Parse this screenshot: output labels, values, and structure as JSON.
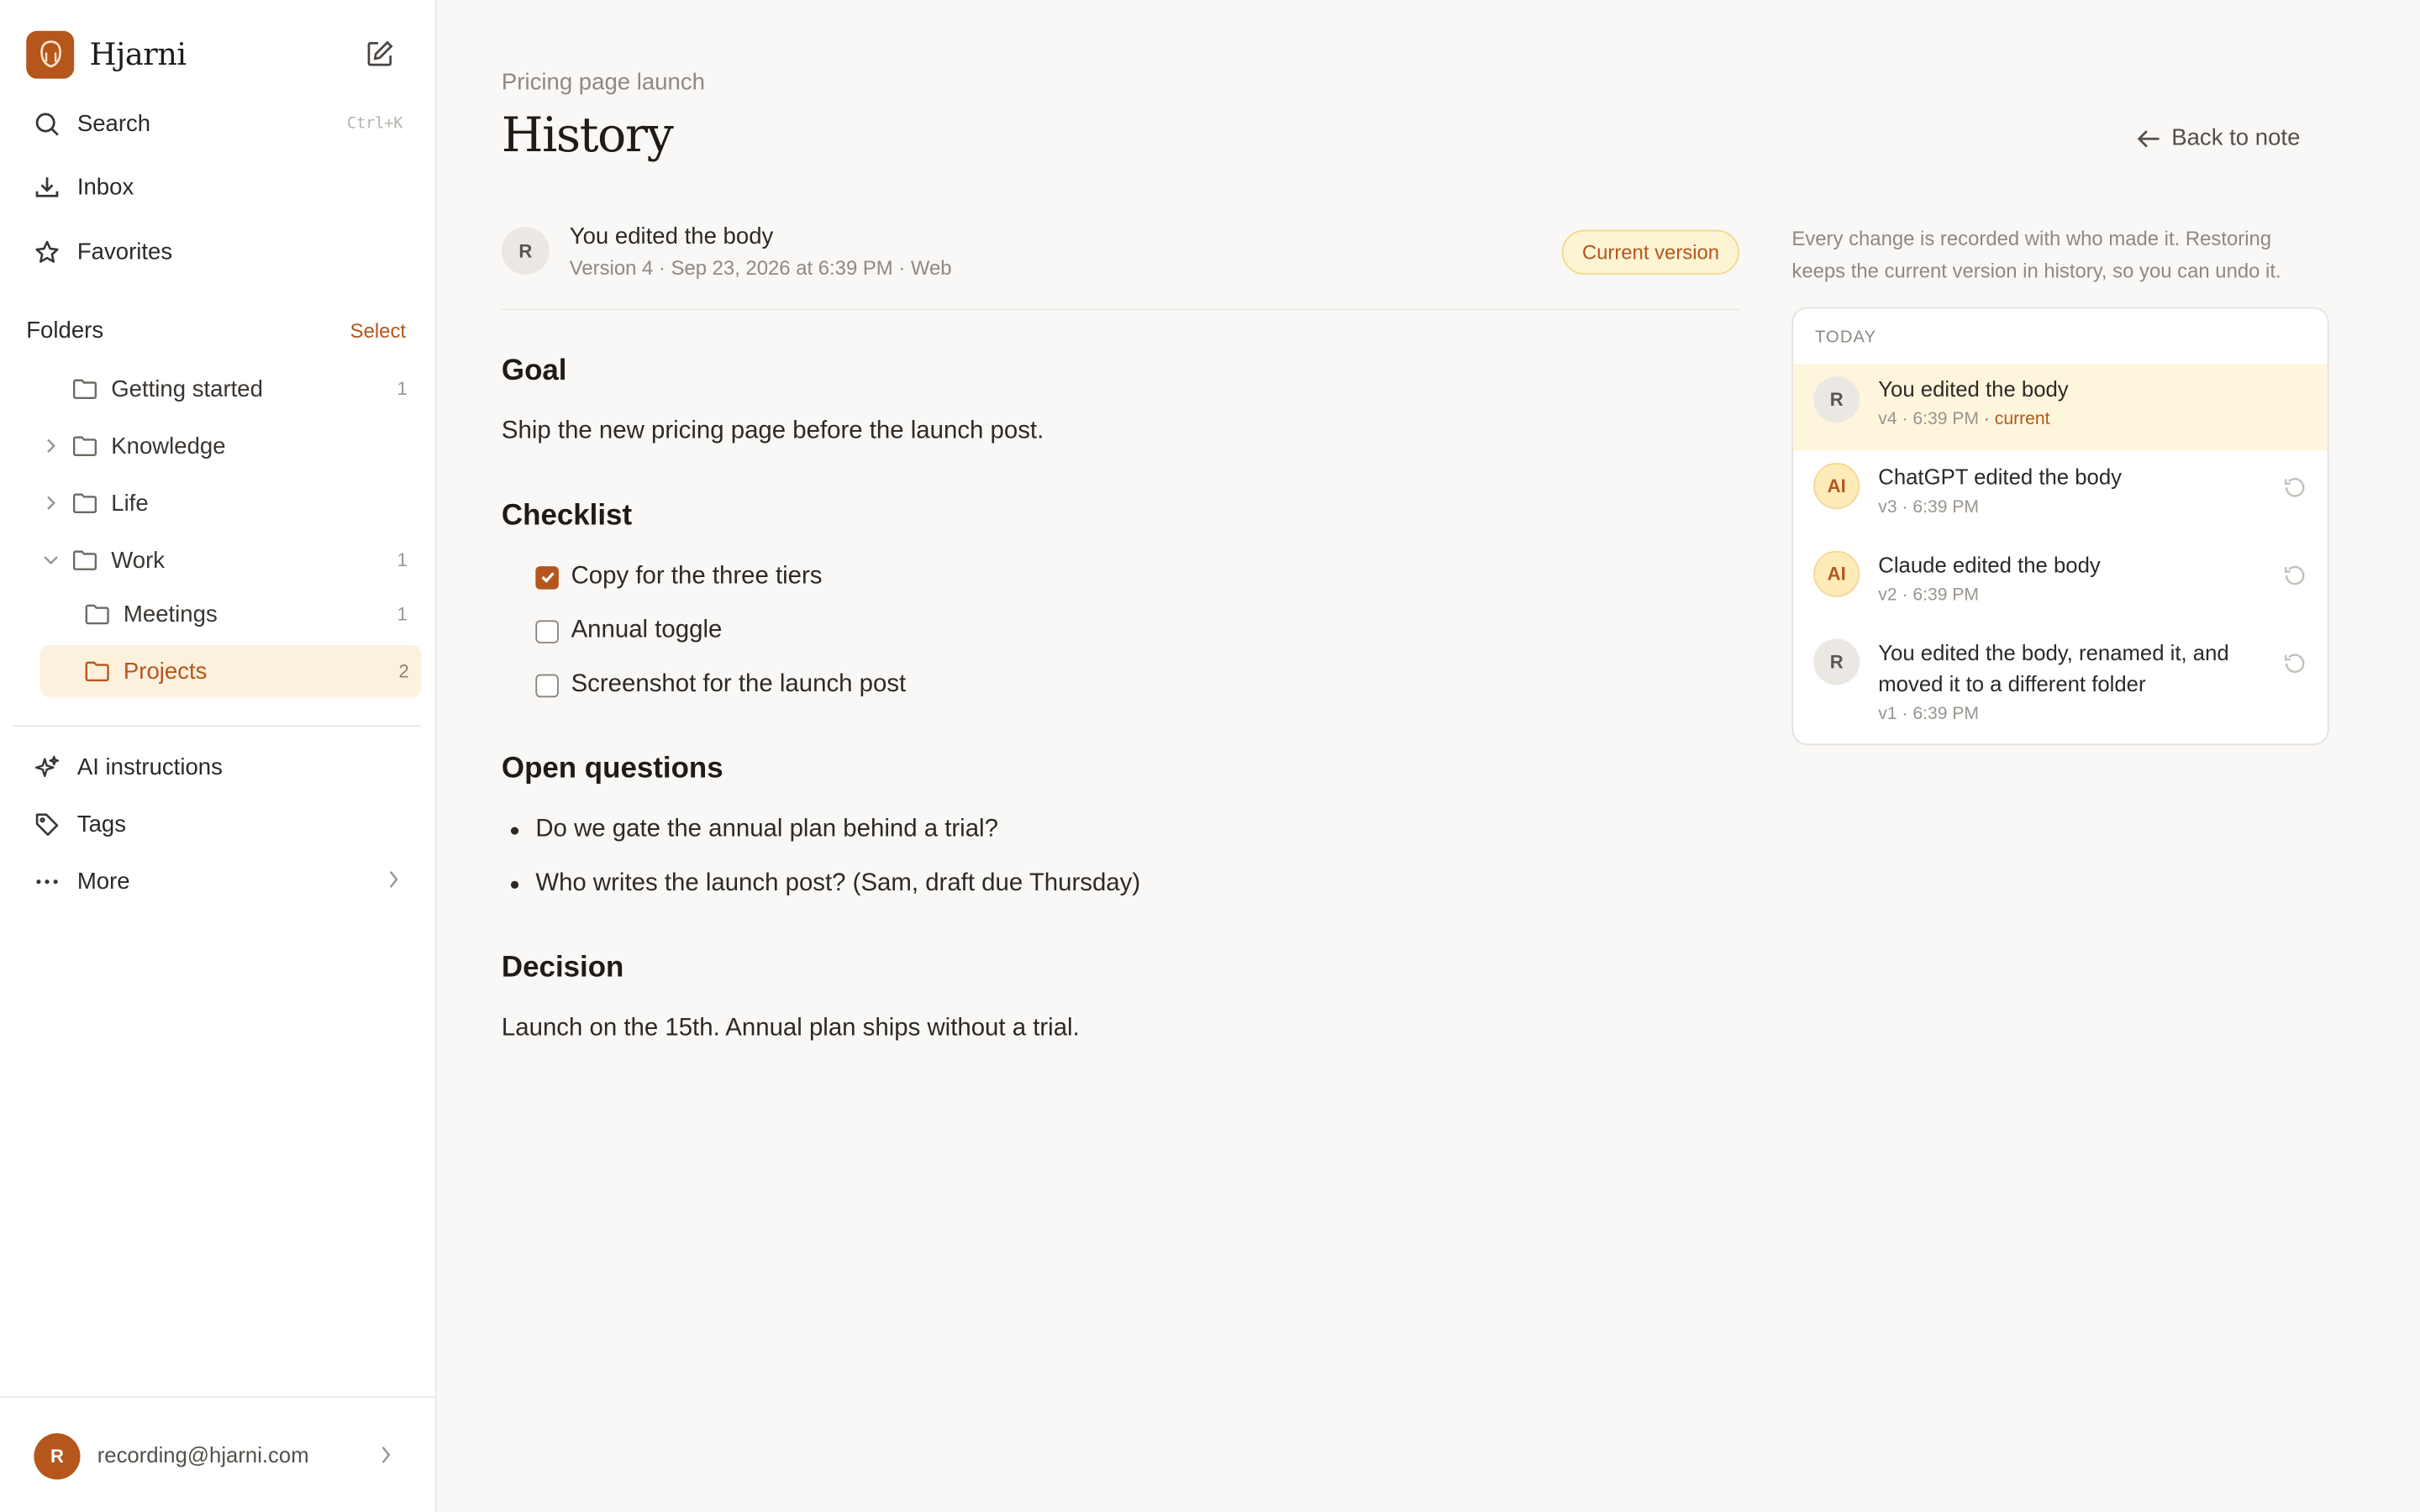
{
  "app": {
    "name": "Hjarni"
  },
  "sidebar": {
    "nav": [
      {
        "label": "Search",
        "shortcut": "Ctrl+K"
      },
      {
        "label": "Inbox"
      },
      {
        "label": "Favorites"
      }
    ],
    "folders_title": "Folders",
    "select_label": "Select",
    "folders": [
      {
        "label": "Getting started",
        "count": "1"
      },
      {
        "label": "Knowledge",
        "count": ""
      },
      {
        "label": "Life",
        "count": ""
      },
      {
        "label": "Work",
        "count": "1"
      },
      {
        "label": "Meetings",
        "count": "1"
      },
      {
        "label": "Projects",
        "count": "2"
      }
    ],
    "bottom": [
      {
        "label": "AI instructions"
      },
      {
        "label": "Tags"
      },
      {
        "label": "More"
      }
    ],
    "user": {
      "initial": "R",
      "email": "recording@hjarni.com"
    }
  },
  "main": {
    "breadcrumb": "Pricing page launch",
    "title": "History",
    "back_label": "Back to note",
    "version": {
      "initial": "R",
      "title": "You edited the body",
      "meta": "Version 4 · Sep 23, 2026 at 6:39 PM · Web",
      "badge": "Current version"
    },
    "content": {
      "goal_heading": "Goal",
      "goal_text": "Ship the new pricing page before the launch post.",
      "checklist_heading": "Checklist",
      "checklist": [
        {
          "label": "Copy for the three tiers",
          "checked": true
        },
        {
          "label": "Annual toggle",
          "checked": false
        },
        {
          "label": "Screenshot for the launch post",
          "checked": false
        }
      ],
      "questions_heading": "Open questions",
      "questions": [
        "Do we gate the annual plan behind a trial?",
        "Who writes the launch post? (Sam, draft due Thursday)"
      ],
      "decision_heading": "Decision",
      "decision_text": "Launch on the 15th. Annual plan ships without a trial."
    }
  },
  "history": {
    "hint": "Every change is recorded with who made it. Restoring keeps the current version in history, so you can undo it.",
    "group_label": "TODAY",
    "items": [
      {
        "initial": "R",
        "title": "You edited the body",
        "meta": "v4 · 6:39 PM",
        "tag": " · current"
      },
      {
        "initial": "AI",
        "title": "ChatGPT edited the body",
        "meta": "v3 · 6:39 PM"
      },
      {
        "initial": "AI",
        "title": "Claude edited the body",
        "meta": "v2 · 6:39 PM"
      },
      {
        "initial": "R",
        "title": "You edited the body, renamed it, and moved it to a different folder",
        "meta": "v1 · 6:39 PM"
      }
    ]
  },
  "colors": {
    "accent": "#b5561c",
    "selected_bg": "#fcf1dc",
    "badge_bg": "#fdf4d4"
  }
}
